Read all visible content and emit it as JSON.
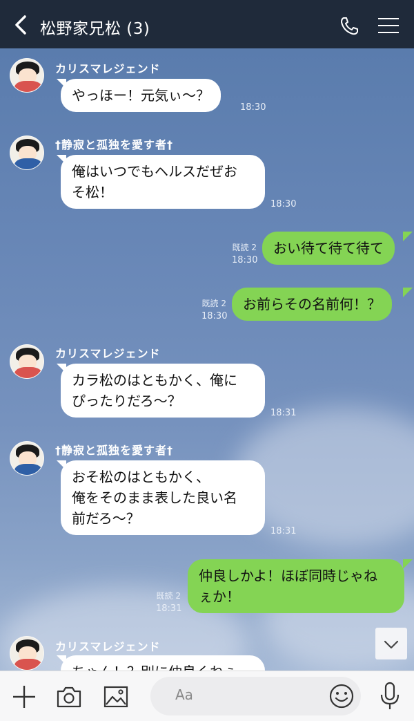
{
  "header": {
    "title": "松野家兄松 (3)"
  },
  "icons": {
    "back": "chevron-left-icon",
    "phone": "phone-icon",
    "menu": "menu-icon",
    "add": "plus-icon",
    "camera": "camera-icon",
    "image": "image-icon",
    "emoji": "emoji-icon",
    "mic": "microphone-icon",
    "scroll": "arrow-down-icon"
  },
  "colors": {
    "header": "#1f2a3a",
    "sent_bubble": "#84d454",
    "received_bubble": "#ffffff"
  },
  "messages": [
    {
      "sender": "カリスマレジェンド",
      "lines": [
        "やっほー！元気ぃ〜？"
      ],
      "time": "18:30"
    },
    {
      "sender": "†静寂と孤独を愛す者†",
      "lines": [
        "俺はいつでもヘルスだぜお",
        "そ松！"
      ],
      "time": "18:30"
    },
    {
      "read": "既読 2",
      "lines": [
        "おい待て待て待て"
      ],
      "time": "18:30"
    },
    {
      "read": "既読 2",
      "lines": [
        "お前らその名前何！？"
      ],
      "time": "18:30"
    },
    {
      "sender": "カリスマレジェンド",
      "lines": [
        "カラ松のはともかく、俺に",
        "ぴったりだろ〜？"
      ],
      "time": "18:31"
    },
    {
      "sender": "†静寂と孤独を愛す者†",
      "lines": [
        "おそ松のはともかく、",
        "俺をそのまま表した良い名",
        "前だろ〜？"
      ],
      "time": "18:31"
    },
    {
      "read": "既読 2",
      "lines": [
        "仲良しかよ！ほぼ同時じゃね",
        "ぇか！"
      ],
      "time": "18:31"
    },
    {
      "sender": "カリスマレジェンド",
      "lines": [
        "ちゃん！？別に仲良くねぇ"
      ]
    }
  ],
  "footer": {
    "input_placeholder": "Aa"
  }
}
